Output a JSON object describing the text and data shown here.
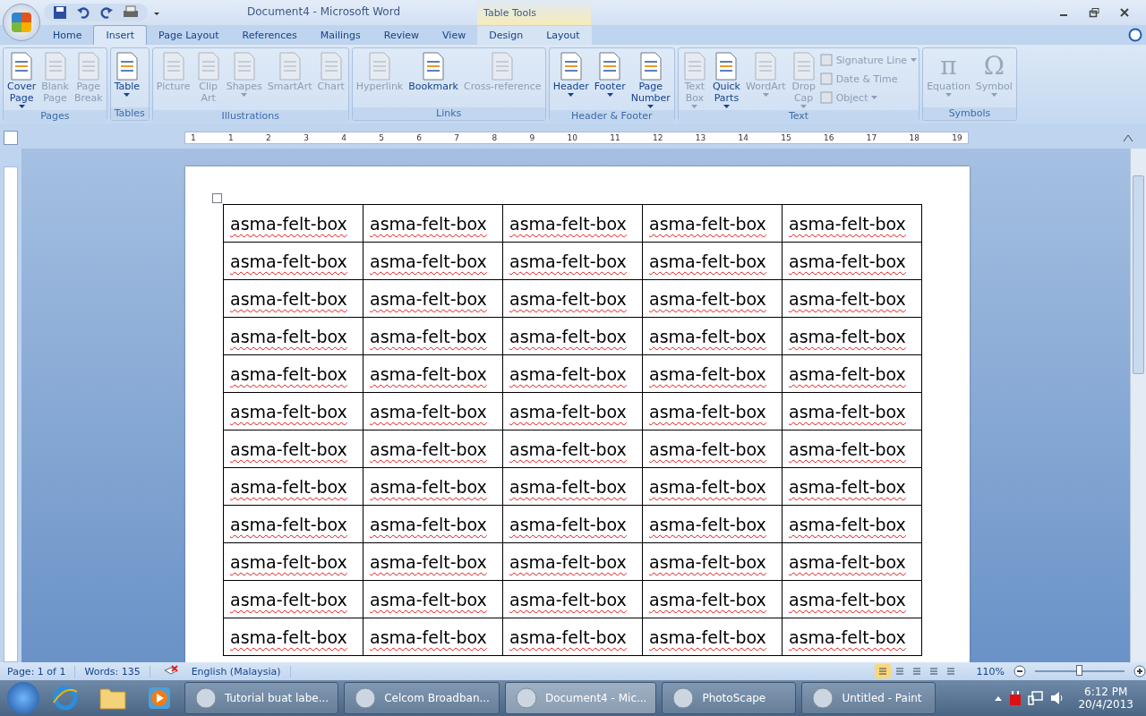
{
  "window": {
    "title": "Document4 - Microsoft Word",
    "contextual_title": "Table Tools"
  },
  "tabs": [
    {
      "label": "Home",
      "selected": false,
      "contextual": false
    },
    {
      "label": "Insert",
      "selected": true,
      "contextual": false
    },
    {
      "label": "Page Layout",
      "selected": false,
      "contextual": false
    },
    {
      "label": "References",
      "selected": false,
      "contextual": false
    },
    {
      "label": "Mailings",
      "selected": false,
      "contextual": false
    },
    {
      "label": "Review",
      "selected": false,
      "contextual": false
    },
    {
      "label": "View",
      "selected": false,
      "contextual": false
    },
    {
      "label": "Design",
      "selected": false,
      "contextual": true
    },
    {
      "label": "Layout",
      "selected": false,
      "contextual": true
    }
  ],
  "ribbon_groups": [
    {
      "name": "Pages",
      "buttons": [
        {
          "kind": "large",
          "label": "Cover\nPage",
          "disabled": false,
          "dropdown": true
        },
        {
          "kind": "large",
          "label": "Blank\nPage",
          "disabled": true,
          "dropdown": false
        },
        {
          "kind": "large",
          "label": "Page\nBreak",
          "disabled": true,
          "dropdown": false
        }
      ]
    },
    {
      "name": "Tables",
      "buttons": [
        {
          "kind": "large",
          "label": "Table",
          "disabled": false,
          "dropdown": true
        }
      ]
    },
    {
      "name": "Illustrations",
      "buttons": [
        {
          "kind": "large",
          "label": "Picture",
          "disabled": true,
          "dropdown": false
        },
        {
          "kind": "large",
          "label": "Clip\nArt",
          "disabled": true,
          "dropdown": false
        },
        {
          "kind": "large",
          "label": "Shapes",
          "disabled": true,
          "dropdown": true
        },
        {
          "kind": "large",
          "label": "SmartArt",
          "disabled": true,
          "dropdown": false
        },
        {
          "kind": "large",
          "label": "Chart",
          "disabled": true,
          "dropdown": false
        }
      ]
    },
    {
      "name": "Links",
      "buttons": [
        {
          "kind": "large",
          "label": "Hyperlink",
          "disabled": true,
          "dropdown": false
        },
        {
          "kind": "large",
          "label": "Bookmark",
          "disabled": false,
          "dropdown": false
        },
        {
          "kind": "large",
          "label": "Cross-reference",
          "disabled": true,
          "dropdown": false
        }
      ]
    },
    {
      "name": "Header & Footer",
      "buttons": [
        {
          "kind": "large",
          "label": "Header",
          "disabled": false,
          "dropdown": true
        },
        {
          "kind": "large",
          "label": "Footer",
          "disabled": false,
          "dropdown": true
        },
        {
          "kind": "large",
          "label": "Page\nNumber",
          "disabled": false,
          "dropdown": true
        }
      ]
    },
    {
      "name": "Text",
      "buttons": [
        {
          "kind": "large",
          "label": "Text\nBox",
          "disabled": true,
          "dropdown": true
        },
        {
          "kind": "large",
          "label": "Quick\nParts",
          "disabled": false,
          "dropdown": true
        },
        {
          "kind": "large",
          "label": "WordArt",
          "disabled": true,
          "dropdown": true
        },
        {
          "kind": "large",
          "label": "Drop\nCap",
          "disabled": true,
          "dropdown": true
        },
        {
          "kind": "small",
          "label": "Signature Line",
          "disabled": true,
          "dropdown": true
        },
        {
          "kind": "small",
          "label": "Date & Time",
          "disabled": true,
          "dropdown": false
        },
        {
          "kind": "small",
          "label": "Object",
          "disabled": true,
          "dropdown": true
        }
      ]
    },
    {
      "name": "Symbols",
      "buttons": [
        {
          "kind": "glyph",
          "glyph": "π",
          "label": "Equation",
          "disabled": true,
          "dropdown": true
        },
        {
          "kind": "glyph",
          "glyph": "Ω",
          "label": "Symbol",
          "disabled": true,
          "dropdown": true
        }
      ]
    }
  ],
  "ruler": {
    "numbers": [
      "1",
      "1",
      "2",
      "3",
      "4",
      "5",
      "6",
      "7",
      "8",
      "9",
      "10",
      "11",
      "12",
      "13",
      "14",
      "15",
      "16",
      "17",
      "18",
      "19"
    ]
  },
  "table": {
    "rows": [
      {
        "cells": [
          "asma-felt-box",
          "asma-felt-box",
          "asma-felt-box",
          "asma-felt-box",
          "asma-felt-box"
        ]
      },
      {
        "cells": [
          "asma-felt-box",
          "asma-felt-box",
          "asma-felt-box",
          "asma-felt-box",
          "asma-felt-box"
        ]
      },
      {
        "cells": [
          "asma-felt-box",
          "asma-felt-box",
          "asma-felt-box",
          "asma-felt-box",
          "asma-felt-box"
        ]
      },
      {
        "cells": [
          "asma-felt-box",
          "asma-felt-box",
          "asma-felt-box",
          "asma-felt-box",
          "asma-felt-box"
        ]
      },
      {
        "cells": [
          "asma-felt-box",
          "asma-felt-box",
          "asma-felt-box",
          "asma-felt-box",
          "asma-felt-box"
        ]
      },
      {
        "cells": [
          "asma-felt-box",
          "asma-felt-box",
          "asma-felt-box",
          "asma-felt-box",
          "asma-felt-box"
        ]
      },
      {
        "cells": [
          "asma-felt-box",
          "asma-felt-box",
          "asma-felt-box",
          "asma-felt-box",
          "asma-felt-box"
        ]
      },
      {
        "cells": [
          "asma-felt-box",
          "asma-felt-box",
          "asma-felt-box",
          "asma-felt-box",
          "asma-felt-box"
        ]
      },
      {
        "cells": [
          "asma-felt-box",
          "asma-felt-box",
          "asma-felt-box",
          "asma-felt-box",
          "asma-felt-box"
        ]
      },
      {
        "cells": [
          "asma-felt-box",
          "asma-felt-box",
          "asma-felt-box",
          "asma-felt-box",
          "asma-felt-box"
        ]
      },
      {
        "cells": [
          "asma-felt-box",
          "asma-felt-box",
          "asma-felt-box",
          "asma-felt-box",
          "asma-felt-box"
        ]
      },
      {
        "cells": [
          "asma-felt-box",
          "asma-felt-box",
          "asma-felt-box",
          "asma-felt-box",
          "asma-felt-box"
        ]
      }
    ]
  },
  "status_bar": {
    "page": "Page: 1 of 1",
    "words": "Words: 135",
    "language": "English (Malaysia)",
    "zoom": "110%",
    "zoom_slider": {
      "level": 0.5
    },
    "views": [
      {
        "selected": true
      },
      {
        "selected": false
      },
      {
        "selected": false
      },
      {
        "selected": false
      },
      {
        "selected": false
      }
    ]
  },
  "taskbar": {
    "tasks": [
      {
        "label": "Tutorial buat labe...",
        "selected": false
      },
      {
        "label": "Celcom Broadban...",
        "selected": false
      },
      {
        "label": "Document4 - Mic...",
        "selected": true
      },
      {
        "label": "PhotoScape",
        "selected": false
      },
      {
        "label": "Untitled - Paint",
        "selected": false
      }
    ],
    "time": "6:12 PM",
    "date": "20/4/2013"
  }
}
